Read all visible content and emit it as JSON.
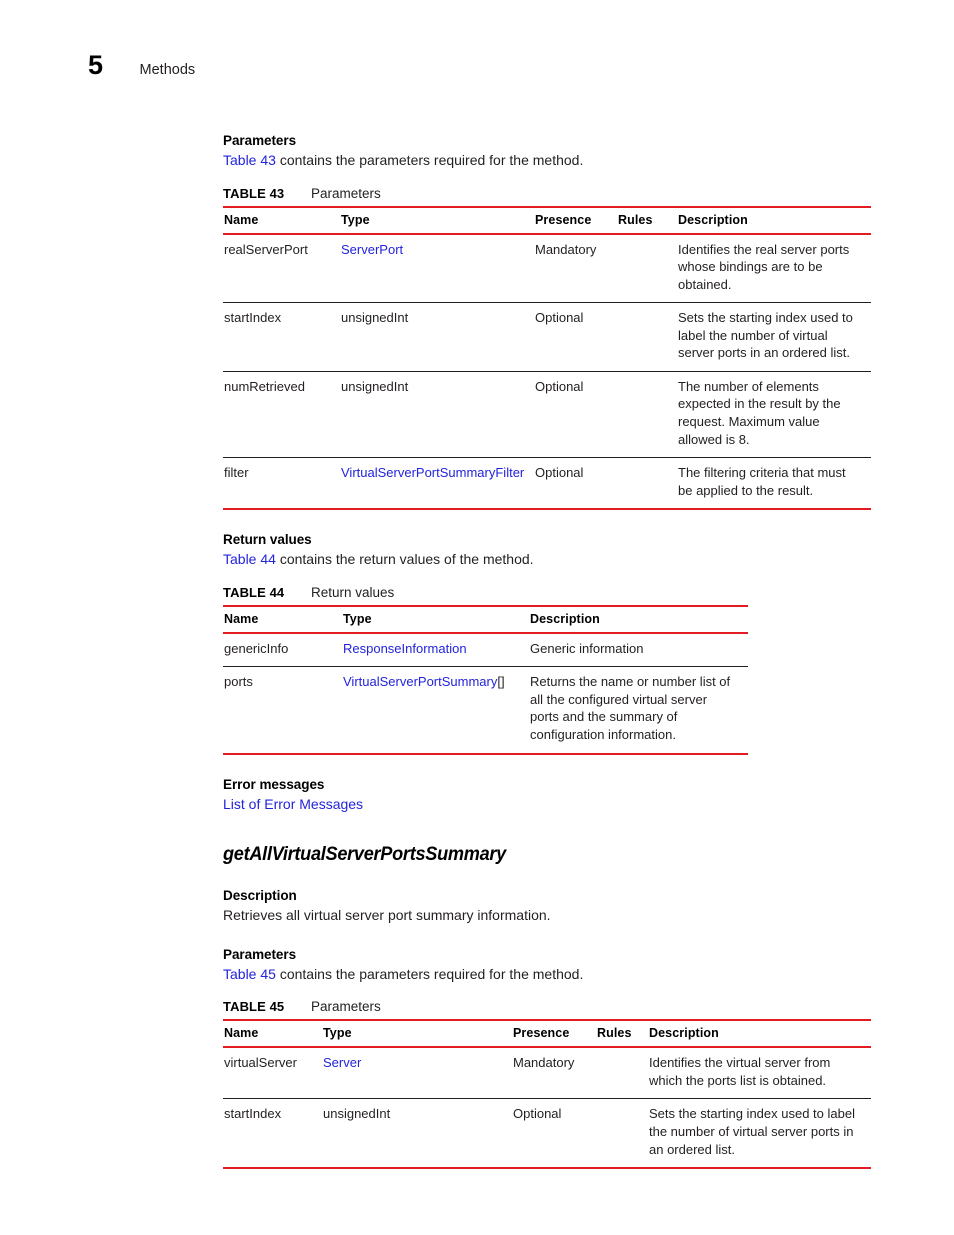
{
  "header": {
    "chapter_number": "5",
    "chapter_title": "Methods"
  },
  "sections": {
    "parameters_heading_1": "Parameters",
    "parameters_intro_1_link": "Table 43",
    "parameters_intro_1_rest": " contains the parameters required for the method.",
    "return_values_heading": "Return values",
    "return_values_intro_link": "Table 44",
    "return_values_intro_rest": " contains the return values of the method.",
    "error_messages_heading": "Error messages",
    "error_messages_link": "List of Error Messages",
    "method_heading": "getAllVirtualServerPortsSummary",
    "description_heading": "Description",
    "description_text": "Retrieves all virtual server port summary information.",
    "parameters_heading_2": "Parameters",
    "parameters_intro_2_link": "Table 45",
    "parameters_intro_2_rest": " contains the parameters required for the method."
  },
  "table43": {
    "number": "TABLE 43",
    "label": "Parameters",
    "columns": [
      "Name",
      "Type",
      "Presence",
      "Rules",
      "Description"
    ],
    "rows": [
      {
        "name": "realServerPort",
        "type": "ServerPort",
        "type_is_link": true,
        "presence": "Mandatory",
        "rules": "",
        "description": "Identifies the real server ports whose bindings are to be obtained."
      },
      {
        "name": "startIndex",
        "type": "unsignedInt",
        "type_is_link": false,
        "presence": "Optional",
        "rules": "",
        "description": "Sets the starting index used to label the number of virtual server ports in an ordered list."
      },
      {
        "name": "numRetrieved",
        "type": "unsignedInt",
        "type_is_link": false,
        "presence": "Optional",
        "rules": "",
        "description": "The number of elements expected in the result by the request. Maximum value allowed is 8."
      },
      {
        "name": "filter",
        "type": "VirtualServerPortSummaryFilter",
        "type_is_link": true,
        "presence": "Optional",
        "rules": "",
        "description": "The filtering criteria that must be applied to the result."
      }
    ]
  },
  "table44": {
    "number": "TABLE 44",
    "label": "Return values",
    "columns": [
      "Name",
      "Type",
      "Description"
    ],
    "rows": [
      {
        "name": "genericInfo",
        "type": "ResponseInformation",
        "type_is_link": true,
        "type_suffix": "",
        "description": "Generic information"
      },
      {
        "name": "ports",
        "type": "VirtualServerPortSummary",
        "type_is_link": true,
        "type_suffix": "[]",
        "description": "Returns the name or number list of all the configured virtual server ports and the summary of configuration information."
      }
    ]
  },
  "table45": {
    "number": "TABLE 45",
    "label": "Parameters",
    "columns": [
      "Name",
      "Type",
      "Presence",
      "Rules",
      "Description"
    ],
    "rows": [
      {
        "name": "virtualServer",
        "type": "Server",
        "type_is_link": true,
        "presence": "Mandatory",
        "rules": "",
        "description": "Identifies the virtual server from which the ports list is obtained."
      },
      {
        "name": "startIndex",
        "type": "unsignedInt",
        "type_is_link": false,
        "presence": "Optional",
        "rules": "",
        "description": "Sets the starting index used to label the number of virtual server ports in an ordered list."
      }
    ]
  },
  "colors": {
    "rule_red": "#e31b23",
    "link_blue": "#2323dd",
    "body_text": "#231f20"
  }
}
